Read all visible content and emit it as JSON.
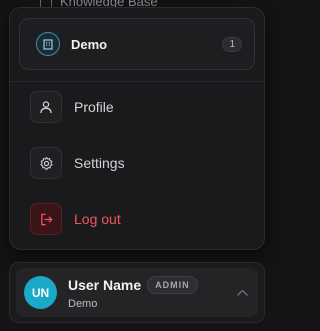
{
  "background_item": {
    "label": "Knowledge Base"
  },
  "menu": {
    "org": {
      "name": "Demo",
      "count": "1",
      "icon": "building-icon"
    },
    "items": [
      {
        "label": "Profile",
        "icon": "user-icon"
      },
      {
        "label": "Settings",
        "icon": "gear-icon"
      },
      {
        "label": "Log out",
        "icon": "logout-icon"
      }
    ]
  },
  "user": {
    "initials": "UN",
    "name": "User Name",
    "role": "ADMIN",
    "org": "Demo",
    "icon": "chevron-up-icon"
  },
  "colors": {
    "accent": "#1aa9c9",
    "danger": "#f0555f",
    "background": "#141416",
    "panel": "#1a1a1c"
  }
}
